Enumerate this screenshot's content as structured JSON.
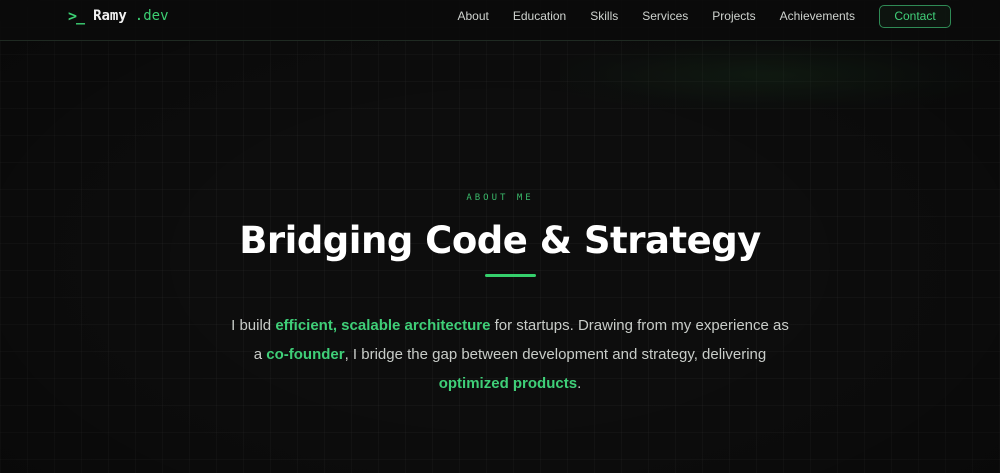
{
  "header": {
    "logo": {
      "icon": ">_",
      "name": "Ramy",
      "suffix": ".dev"
    },
    "nav": [
      {
        "label": "About"
      },
      {
        "label": "Education"
      },
      {
        "label": "Skills"
      },
      {
        "label": "Services"
      },
      {
        "label": "Projects"
      },
      {
        "label": "Achievements"
      }
    ],
    "contact_label": "Contact"
  },
  "about": {
    "eyebrow": "ABOUT ME",
    "title": "Bridging Code & Strategy",
    "description": {
      "t1": "I build ",
      "h1": "efficient, scalable architecture",
      "t2": " for startups. Drawing from my experience as a ",
      "h2": "co-founder",
      "t3": ", I bridge the gap between development and strategy, delivering ",
      "h3": "optimized products",
      "t4": "."
    }
  },
  "theme": {
    "background": "#0c0c0c",
    "accent": "#3ccf73",
    "text": "#ffffff",
    "muted_text": "#c8ccc8"
  }
}
